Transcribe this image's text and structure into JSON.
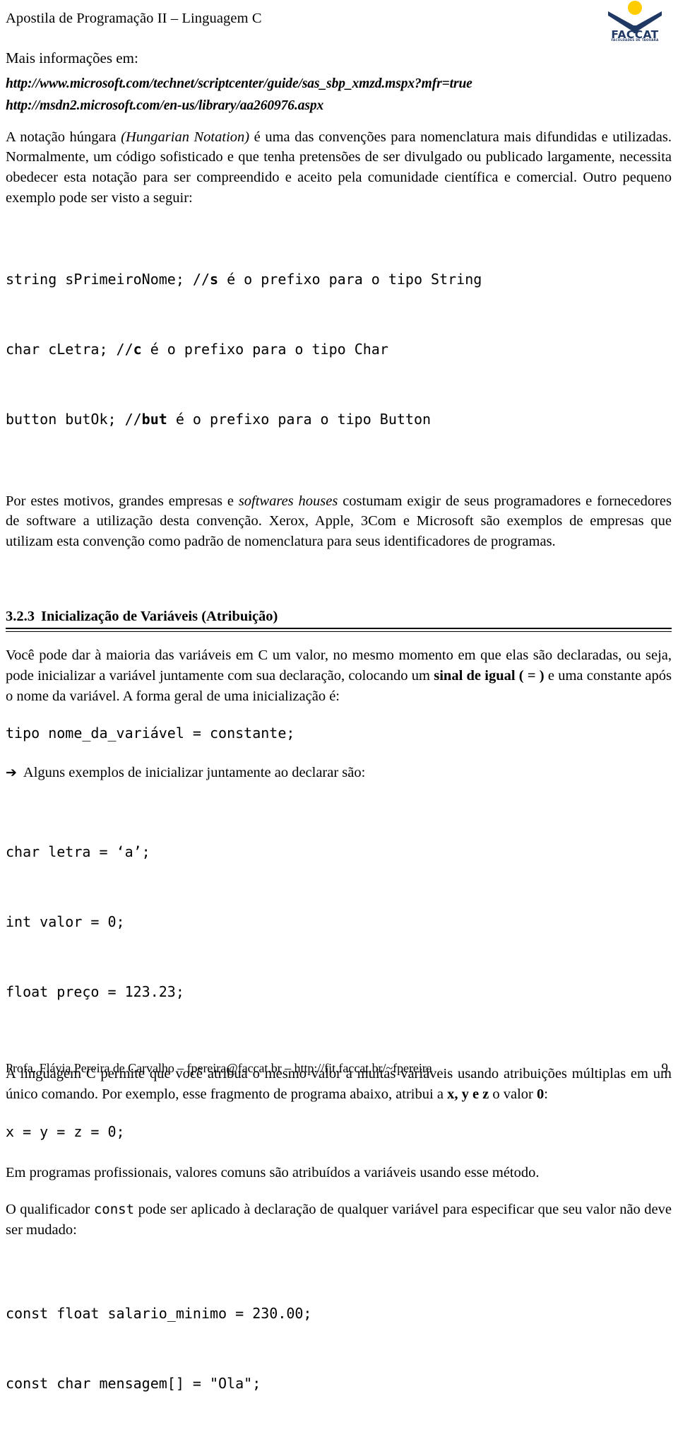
{
  "header": {
    "title": "Apostila de Programação II – Linguagem C",
    "logo": {
      "name": "FACCAT",
      "subtitle": "FACULDADES DE TAQUARA",
      "blue": "#1F3864",
      "yellow": "#FFCC00"
    }
  },
  "content": {
    "more_info_label": "Mais informações em:",
    "urls": [
      "http://www.microsoft.com/technet/scriptcenter/guide/sas_sbp_xmzd.mspx?mfr=true",
      "http://msdn2.microsoft.com/en-us/library/aa260976.aspx"
    ],
    "para_hungarian": {
      "p1": "A notação húngara ",
      "em1": "(Hungarian Notation)",
      "p2": " é uma das convenções para nomenclatura mais difundidas e utilizadas. Normalmente, um código sofisticado e que tenha pretensões de ser divulgado ou publicado largamente, necessita obedecer esta notação para ser compreendido e aceito pela comunidade científica e comercial. Outro pequeno exemplo pode ser visto a seguir:"
    },
    "code_prefixes": [
      {
        "pre": "string sPrimeiroNome; //",
        "bold": "s",
        "post": " é o prefixo para o tipo String"
      },
      {
        "pre": "char cLetra; //",
        "bold": "c",
        "post": " é o prefixo para o tipo Char"
      },
      {
        "pre": "button butOk; //",
        "bold": "but",
        "post": " é o prefixo para o tipo Button"
      }
    ],
    "para_empresas": {
      "p1": "Por estes motivos, grandes empresas e ",
      "em1": "softwares houses",
      "p2": " costumam exigir de seus programadores e fornecedores de software a utilização desta convenção. Xerox, Apple, 3Com e Microsoft são exemplos de empresas que utilizam esta convenção como padrão de nomenclatura para seus identificadores de programas."
    },
    "section": {
      "number": "3.2.3",
      "title": "Inicialização de Variáveis (Atribuição)"
    },
    "para_init": {
      "p1": "Você pode dar à maioria das variáveis em C um valor, no mesmo momento em que elas são declaradas, ou seja, pode inicializar a variável juntamente com sua declaração, colocando um ",
      "b1": "sinal de igual ( = )",
      "p2": " e uma constante após o nome da variável. A forma geral de uma inicialização é:"
    },
    "code_general_form": "tipo nome_da_variável = constante;",
    "arrow_item": {
      "glyph": "➔",
      "text": "Alguns exemplos de inicializar juntamente ao declarar são:"
    },
    "code_examples": [
      "char letra = ‘a’;",
      "int valor = 0;",
      "float preço = 123.23;"
    ],
    "para_multiple": {
      "p1": "A linguagem C permite que você atribua o mesmo valor a muitas variáveis usando atribuições múltiplas em um único comando. Por exemplo, esse fragmento de programa abaixo, atribui a ",
      "b1": "x, y e z",
      "p2": " o valor ",
      "b2": "0",
      "p3": ":"
    },
    "code_multiple": "x = y = z = 0;",
    "para_professional": "Em programas profissionais, valores comuns são atribuídos a variáveis usando esse método.",
    "para_const": {
      "p1": "O qualificador ",
      "code1": "const",
      "p2": " pode ser aplicado à declaração de qualquer variável para especificar que seu valor não deve ser mudado:"
    },
    "code_const": [
      "const float salario_minimo = 230.00;",
      "const char mensagem[] = \"Ola\";"
    ]
  },
  "footer": {
    "text": "Profa. Flávia Pereira de Carvalho – fpereira@faccat.br – http://fit.faccat.br/~fpereira",
    "page_number": "9"
  }
}
